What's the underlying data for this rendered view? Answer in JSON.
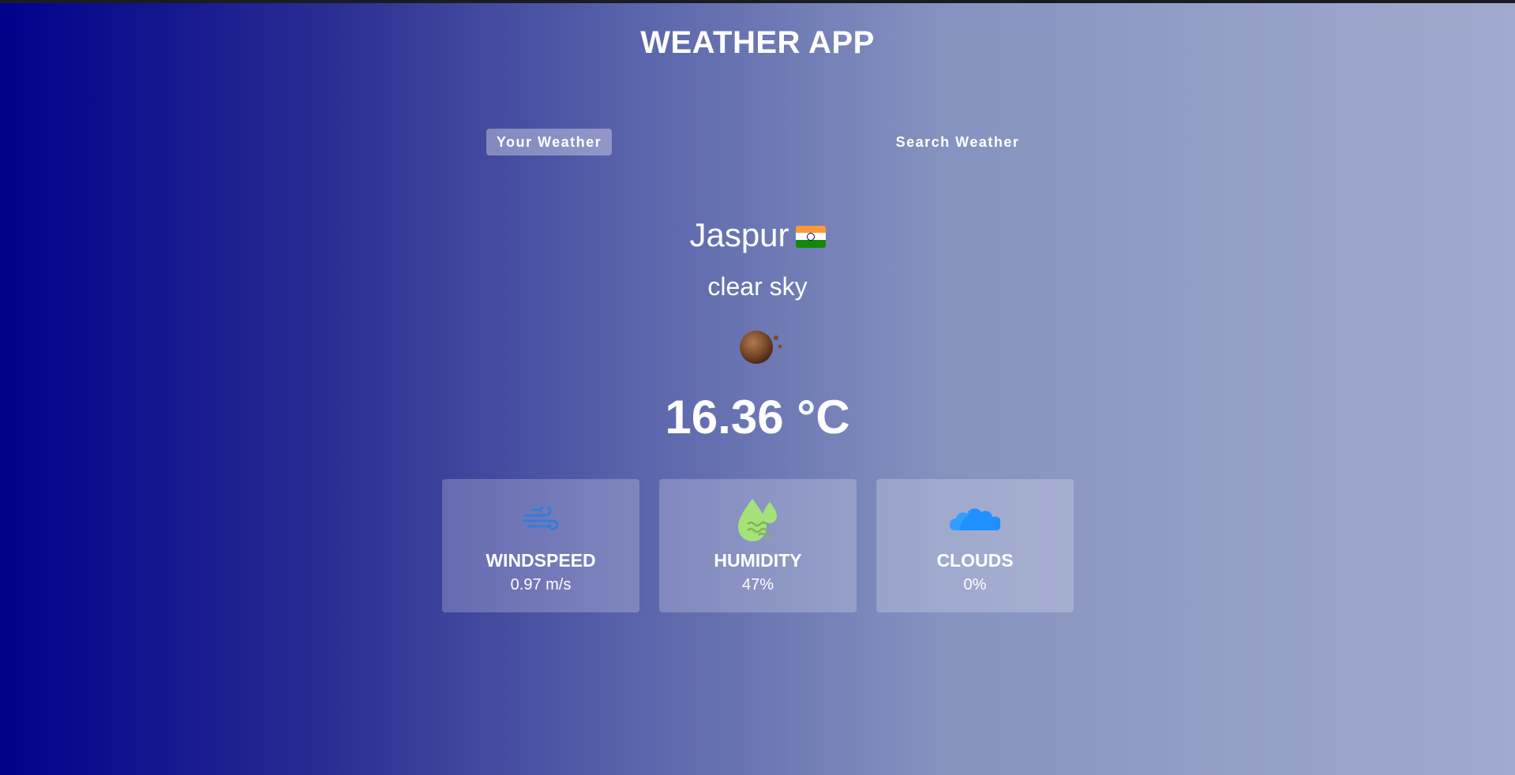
{
  "app": {
    "title": "WEATHER APP"
  },
  "tabs": [
    {
      "label": "Your Weather",
      "active": true
    },
    {
      "label": "Search Weather",
      "active": false
    }
  ],
  "location": {
    "city": "Jaspur",
    "flag": "india-flag-icon"
  },
  "weather": {
    "description": "clear sky",
    "icon": "clear-sky-icon",
    "temperature": "16.36 °C"
  },
  "stats": [
    {
      "label": "WINDSPEED",
      "value": "0.97 m/s",
      "icon": "wind-icon"
    },
    {
      "label": "HUMIDITY",
      "value": "47%",
      "icon": "humidity-icon"
    },
    {
      "label": "CLOUDS",
      "value": "0%",
      "icon": "cloud-icon"
    }
  ],
  "colors": {
    "gradient_start": "#00008b",
    "gradient_end": "#a0aacd",
    "wind_icon": "#2f7ed8",
    "humidity_icon": "#a6e27a",
    "cloud_icon": "#1e90ff"
  }
}
